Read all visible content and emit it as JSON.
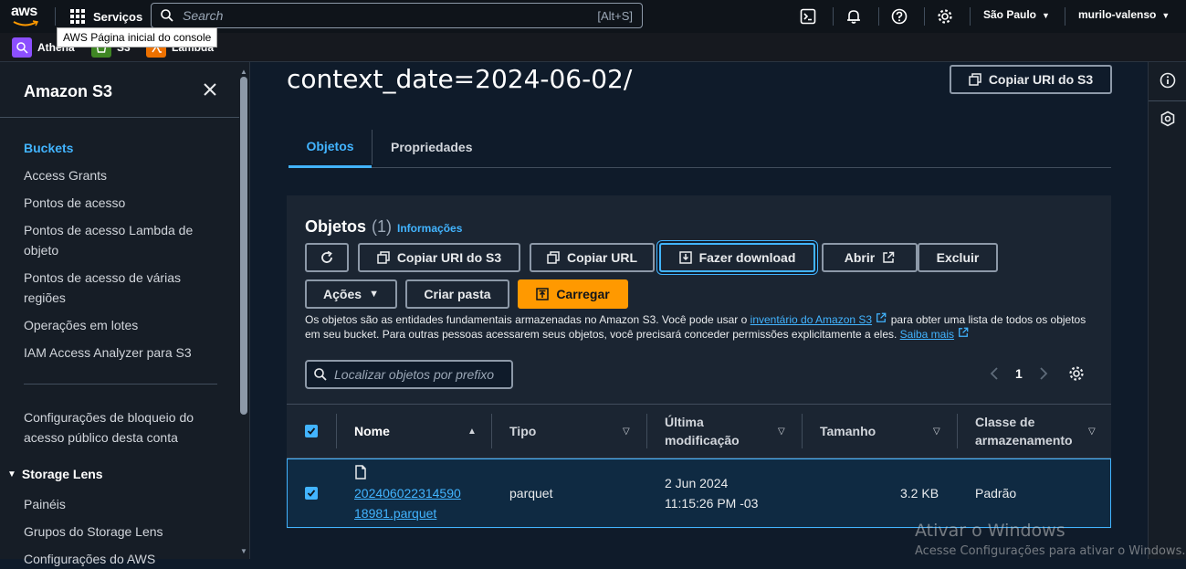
{
  "topbar": {
    "logo_text": "aws",
    "services_label": "Serviços",
    "search_placeholder": "Search",
    "search_shortcut": "[Alt+S]",
    "region": "São Paulo",
    "user": "murilo-valenso",
    "icons": [
      "cloudshell-icon",
      "notifications-icon",
      "help-icon",
      "settings-icon"
    ]
  },
  "favorites": {
    "tooltip": "AWS Página inicial do console",
    "items": [
      {
        "label": "Athena",
        "color": "#8c4fff"
      },
      {
        "label": "S3",
        "color": "#3f8624"
      },
      {
        "label": "Lambda",
        "color": "#ed7100"
      }
    ]
  },
  "sidebar": {
    "title": "Amazon S3",
    "items": [
      {
        "label": "Buckets",
        "active": true
      },
      {
        "label": "Access Grants"
      },
      {
        "label": "Pontos de acesso"
      },
      {
        "label": "Pontos de acesso Lambda de objeto"
      },
      {
        "label": "Pontos de acesso de várias regiões"
      },
      {
        "label": "Operações em lotes"
      },
      {
        "label": "IAM Access Analyzer para S3"
      },
      {
        "label": "Configurações de bloqueio do acesso público desta conta"
      }
    ],
    "section": "Storage Lens",
    "section_items": [
      "Painéis",
      "Grupos do Storage Lens",
      "Configurações do AWS"
    ]
  },
  "main": {
    "title": "context_date=2024-06-02/",
    "copy_uri_label": "Copiar URI do S3",
    "tabs": [
      {
        "label": "Objetos",
        "active": true
      },
      {
        "label": "Propriedades"
      }
    ],
    "panel": {
      "heading": "Objetos",
      "count": "(1)",
      "info": "Informações",
      "buttons": {
        "copy_uri": "Copiar URI do S3",
        "copy_url": "Copiar URL",
        "download": "Fazer download",
        "open": "Abrir",
        "delete": "Excluir",
        "actions": "Ações",
        "create_folder": "Criar pasta",
        "upload": "Carregar"
      },
      "desc_1": "Os objetos são as entidades fundamentais armazenadas no Amazon S3. Você pode usar o ",
      "desc_link1": "inventário do Amazon S3",
      "desc_2": " para obter uma lista de todos os objetos em seu bucket. Para outras pessoas acessarem seus objetos, você precisará conceder permissões explicitamente a eles. ",
      "desc_link2": "Saiba mais",
      "filter_placeholder": "Localizar objetos por prefixo",
      "page": "1",
      "columns": [
        {
          "label": "Nome"
        },
        {
          "label": "Tipo"
        },
        {
          "label_1": "Última",
          "label_2": "modificação"
        },
        {
          "label": "Tamanho"
        },
        {
          "label_1": "Classe de",
          "label_2": "armazenamento"
        }
      ],
      "rows": [
        {
          "name_1": "202406022314590",
          "name_2": "18981.parquet",
          "type": "parquet",
          "modified_1": "2 Jun 2024",
          "modified_2": "11:15:26 PM -03",
          "size": "3.2 KB",
          "storage_class": "Padrão",
          "selected": true
        }
      ]
    }
  },
  "watermark": {
    "line1": "Ativar o Windows",
    "line2": "Acesse Configurações para ativar o Windows."
  }
}
